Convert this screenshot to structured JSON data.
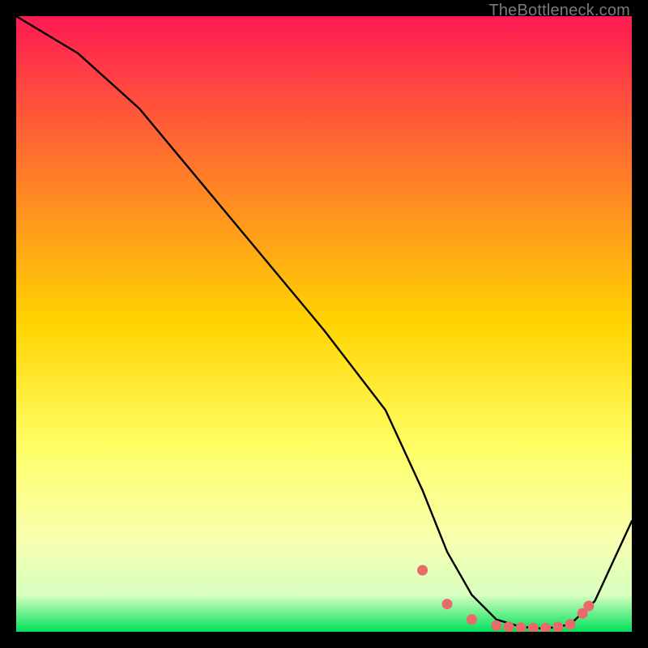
{
  "watermark": "TheBottleneck.com",
  "colors": {
    "gradient_top": "#ff1a54",
    "gradient_mid1": "#ff7a2a",
    "gradient_mid2": "#ffd400",
    "gradient_mid3": "#ffff66",
    "gradient_mid4": "#f7ffb0",
    "gradient_bottom": "#00e05a",
    "curve": "#000000",
    "marker": "#e96a6a",
    "frame": "#000000"
  },
  "chart_data": {
    "type": "line",
    "title": "",
    "xlabel": "",
    "ylabel": "",
    "xlim": [
      0,
      100
    ],
    "ylim": [
      0,
      100
    ],
    "grid": false,
    "legend": false,
    "x": [
      0,
      10,
      20,
      30,
      40,
      50,
      60,
      66,
      70,
      74,
      78,
      82,
      86,
      90,
      94,
      100
    ],
    "values": [
      100,
      94,
      85,
      73,
      61,
      49,
      36,
      23,
      13,
      6,
      2,
      0.8,
      0.5,
      1.2,
      5,
      18
    ],
    "markers": {
      "x": [
        66,
        70,
        74,
        78,
        80,
        82,
        84,
        86,
        88,
        90,
        92,
        93
      ],
      "y": [
        10,
        4.5,
        2,
        1,
        0.8,
        0.7,
        0.6,
        0.6,
        0.8,
        1.2,
        3,
        4.2
      ]
    }
  }
}
